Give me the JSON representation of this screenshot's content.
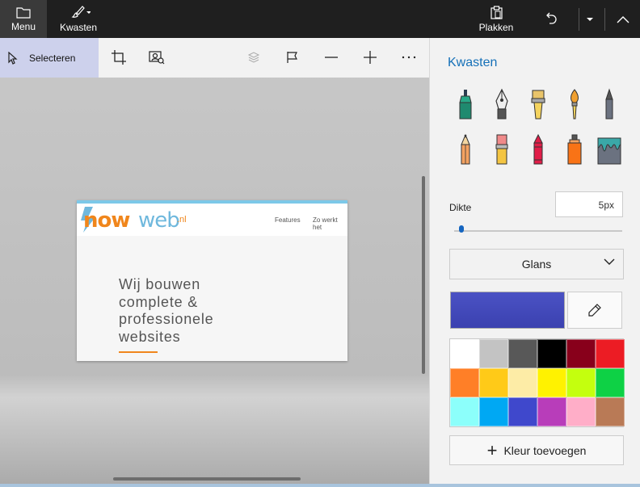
{
  "topbar": {
    "menu_label": "Menu",
    "brushes_label": "Kwasten",
    "paste_label": "Plakken"
  },
  "toolbar": {
    "select_label": "Selecteren"
  },
  "canvas_image": {
    "logo_now": "now",
    "logo_web": "web",
    "logo_tld": ".nl",
    "nav_features": "Features",
    "nav_how": "Zo werkt het",
    "headline_lines": [
      "Wij bouwen",
      "complete &",
      "professionele",
      "websites"
    ]
  },
  "panel": {
    "title": "Kwasten",
    "brushes": [
      {
        "icon": "calligraphy-pen-icon",
        "color": "#27a887"
      },
      {
        "icon": "fountain-pen-icon",
        "color": "#555555"
      },
      {
        "icon": "flat-brush-icon",
        "color": "#e9c46a"
      },
      {
        "icon": "round-brush-icon",
        "color": "#f0a030"
      },
      {
        "icon": "marker-icon",
        "color": "#6b7280"
      },
      {
        "icon": "pencil-icon",
        "color": "#f4a261"
      },
      {
        "icon": "eraser-icon",
        "color": "#f08a8a"
      },
      {
        "icon": "crayon-icon",
        "color": "#e11d48"
      },
      {
        "icon": "spray-can-icon",
        "color": "#f97316"
      },
      {
        "icon": "paint-bucket-icon",
        "color": "#3aa8a8"
      }
    ],
    "thickness_label": "Dikte",
    "thickness_value": "5px",
    "thickness_level": 0.03,
    "texture_label": "Glans",
    "current_color": "#3b41b0",
    "palette": [
      "#ffffff",
      "#c3c3c3",
      "#585858",
      "#000000",
      "#88001b",
      "#ec1c24",
      "#ff7f27",
      "#ffca18",
      "#fdeca6",
      "#fff200",
      "#c4ff0e",
      "#0ed145",
      "#8cfffb",
      "#00a8f3",
      "#3f48cc",
      "#b83dba",
      "#ffaec8",
      "#b97a56"
    ],
    "add_color_label": "Kleur toevoegen"
  }
}
